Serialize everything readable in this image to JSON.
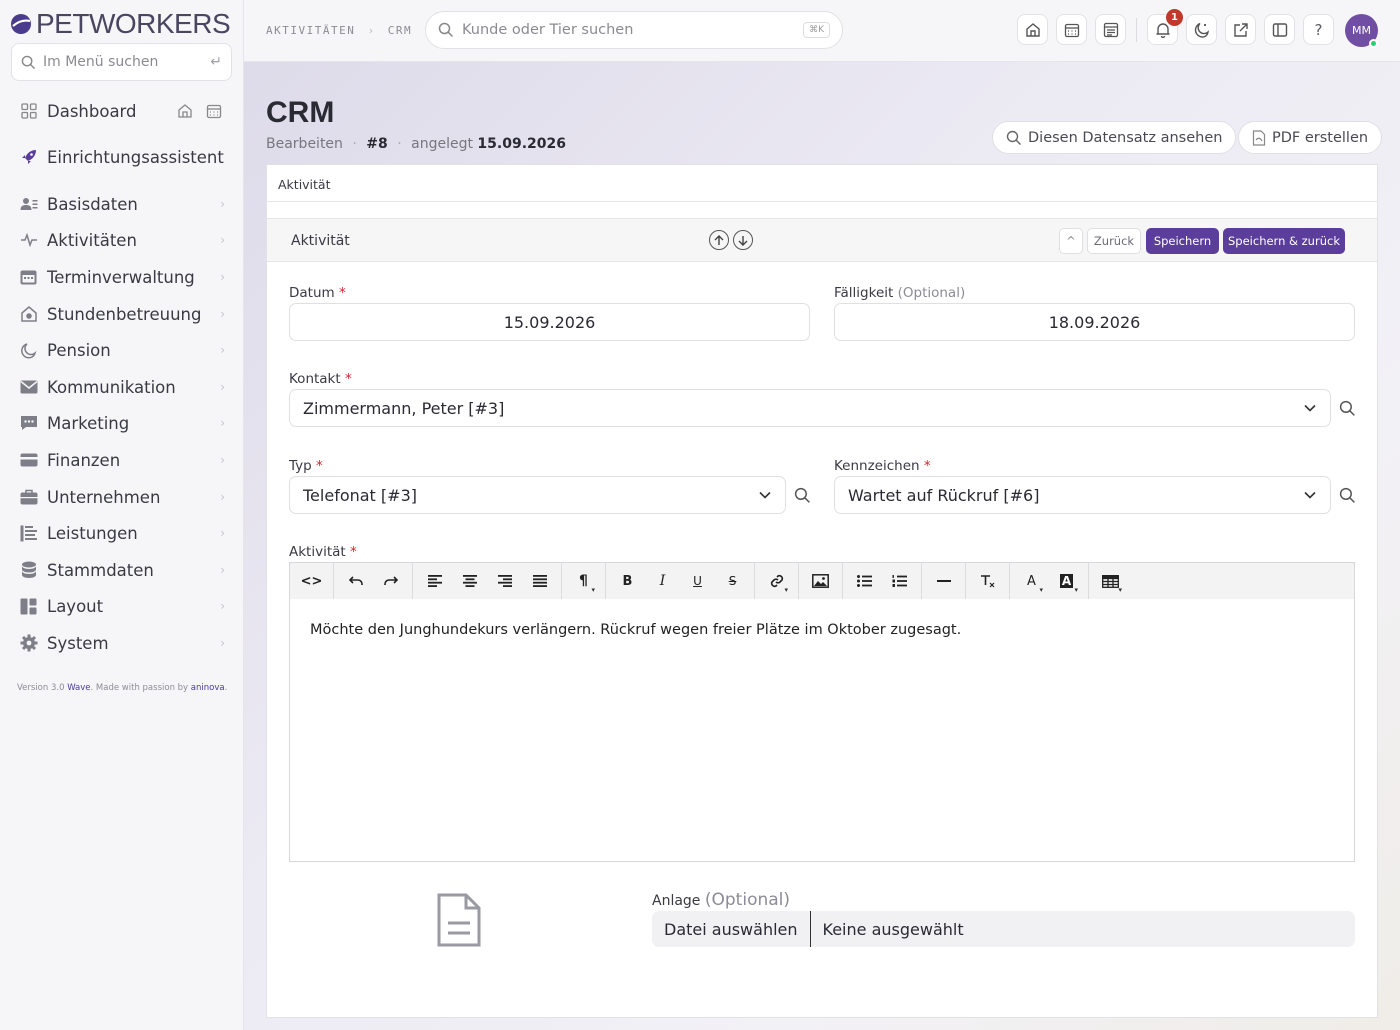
{
  "brand": {
    "name": "PETWORKERS"
  },
  "sidebar": {
    "search_placeholder": "Im Menü suchen",
    "items": [
      {
        "label": "Dashboard",
        "icon": "dashboard-icon"
      },
      {
        "label": "Einrichtungsassistent",
        "icon": "rocket-icon"
      },
      {
        "label": "Basisdaten",
        "icon": "users-icon"
      },
      {
        "label": "Aktivitäten",
        "icon": "activity-icon"
      },
      {
        "label": "Terminverwaltung",
        "icon": "calendar-icon"
      },
      {
        "label": "Stundenbetreuung",
        "icon": "house-paw-icon"
      },
      {
        "label": "Pension",
        "icon": "moon-icon"
      },
      {
        "label": "Kommunikation",
        "icon": "envelope-icon"
      },
      {
        "label": "Marketing",
        "icon": "chat-icon"
      },
      {
        "label": "Finanzen",
        "icon": "credit-card-icon"
      },
      {
        "label": "Unternehmen",
        "icon": "briefcase-icon"
      },
      {
        "label": "Leistungen",
        "icon": "list-icon"
      },
      {
        "label": "Stammdaten",
        "icon": "database-icon"
      },
      {
        "label": "Layout",
        "icon": "layout-icon"
      },
      {
        "label": "System",
        "icon": "gear-icon"
      }
    ],
    "version_prefix": "Version 3.0",
    "version_product": "Wave",
    "version_mid": ". Made with passion by",
    "version_company": "aninova",
    "version_end": "."
  },
  "header": {
    "breadcrumb": [
      "AKTIVITÄTEN",
      "CRM"
    ],
    "breadcrumb_sep": "›",
    "search_placeholder": "Kunde oder Tier suchen",
    "search_shortcut": "⌘K",
    "notification_count": "1",
    "help_label": "?",
    "avatar_initials": "MM"
  },
  "page": {
    "title": "CRM",
    "mode": "Bearbeiten",
    "record_id": "#8",
    "created_label": "angelegt",
    "created_date": "15.09.2026",
    "view_record_button": "Diesen Datensatz ansehen",
    "pdf_button": "PDF erstellen"
  },
  "card": {
    "tab_label": "Aktivität",
    "section_title": "Aktivität",
    "actions": {
      "up": "^",
      "back": "Zurück",
      "save": "Speichern",
      "save_back": "Speichern & zurück"
    }
  },
  "form": {
    "required_mark": "*",
    "datum": {
      "label": "Datum",
      "value": "15.09.2026"
    },
    "faelligkeit": {
      "label": "Fälligkeit",
      "optional": "(Optional)",
      "value": "18.09.2026"
    },
    "kontakt": {
      "label": "Kontakt",
      "value": "Zimmermann, Peter [#3]"
    },
    "typ": {
      "label": "Typ",
      "value": "Telefonat [#3]"
    },
    "kennzeichen": {
      "label": "Kennzeichen",
      "value": "Wartet auf Rückruf [#6]"
    },
    "aktivitaet": {
      "label": "Aktivität",
      "content": "Möchte den Junghundekurs verlängern. Rückruf wegen freier Plätze im Oktober zugesagt."
    },
    "anlage": {
      "label": "Anlage",
      "optional": "(Optional)",
      "button": "Datei auswählen",
      "status": "Keine ausgewählt"
    }
  },
  "editor_toolbar": {
    "bold": "B",
    "italic": "I",
    "underline": "U",
    "strike": "S",
    "font_color": "A",
    "bg_color": "A",
    "paragraph": "¶",
    "code": "<>"
  },
  "colors": {
    "accent": "#5b3d9b",
    "required": "#d0222e",
    "badge": "#c0392b"
  }
}
